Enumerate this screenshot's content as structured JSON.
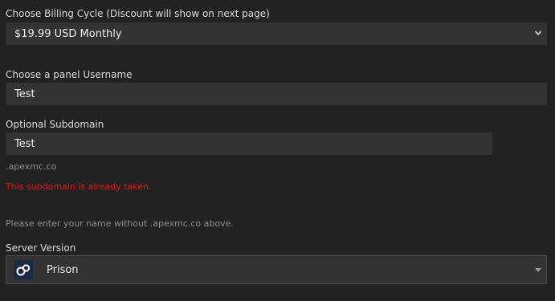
{
  "billing": {
    "label": "Choose Billing Cycle (Discount will show on next page)",
    "selected": "$19.99 USD Monthly"
  },
  "username": {
    "label": "Choose a panel Username",
    "value": "Test"
  },
  "subdomain": {
    "label": "Optional Subdomain",
    "value": "Test",
    "suffix": ".apexmc.co",
    "error": "This subdomain is already taken.",
    "help": "Please enter your name without .apexmc.co above."
  },
  "server_version": {
    "label": "Server Version",
    "selected": "Prison",
    "icon": "handcuffs-icon"
  },
  "colors": {
    "background": "#222222",
    "field": "#333333",
    "error": "#e01818"
  }
}
